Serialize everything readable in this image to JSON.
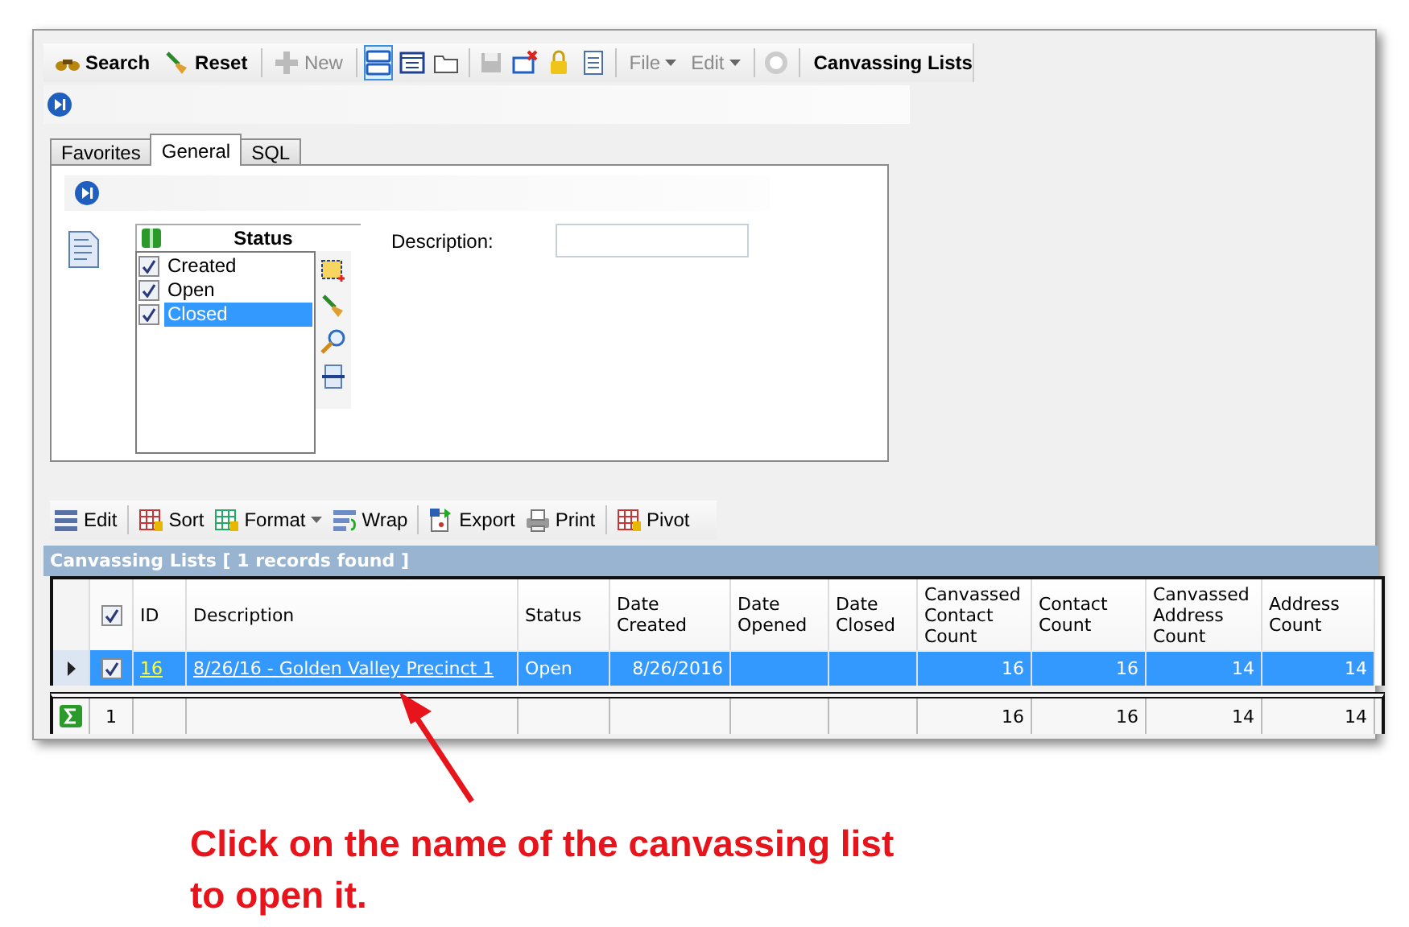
{
  "toolbar": {
    "buttons": [
      {
        "label": "Search",
        "disabled": false
      },
      {
        "label": "Reset",
        "disabled": false
      },
      {
        "label": "New",
        "disabled": true
      }
    ],
    "menus": [
      {
        "label": "File",
        "disabled": true
      },
      {
        "label": "Edit",
        "disabled": true
      }
    ],
    "title": "Canvassing Lists"
  },
  "tabs": [
    {
      "label": "Favorites",
      "selected": false
    },
    {
      "label": "General",
      "selected": true
    },
    {
      "label": "SQL",
      "selected": false
    }
  ],
  "filter": {
    "status_title": "Status",
    "statuses": [
      {
        "label": "Created",
        "checked": true,
        "selected": false
      },
      {
        "label": "Open",
        "checked": true,
        "selected": false
      },
      {
        "label": "Closed",
        "checked": true,
        "selected": true
      }
    ],
    "description_label": "Description:"
  },
  "grid_toolbar": [
    {
      "label": "Edit",
      "has_menu": false
    },
    {
      "label": "Sort",
      "has_menu": false
    },
    {
      "label": "Format",
      "has_menu": true
    },
    {
      "label": "Wrap",
      "has_menu": false
    },
    {
      "label": "Export",
      "has_menu": false
    },
    {
      "label": "Print",
      "has_menu": false
    },
    {
      "label": "Pivot",
      "has_menu": false
    }
  ],
  "grid": {
    "title": "Canvassing Lists [ 1 records found ]",
    "header_checked": true,
    "columns": [
      "ID",
      "Description",
      "Status",
      "Date Created",
      "Date Opened",
      "Date Closed",
      "Canvassed Contact Count",
      "Contact Count",
      "Canvassed Address Count",
      "Address Count"
    ],
    "rows": [
      {
        "selected": true,
        "checked": true,
        "id": "16",
        "description": "8/26/16 - Golden Valley Precinct 1",
        "status": "Open",
        "date_created": "8/26/2016",
        "canvassed_contact_count": "16",
        "contact_count": "16",
        "canvassed_address_count": "14",
        "address_count": "14"
      }
    ],
    "footer": {
      "count": "1",
      "totals": [
        "16",
        "16",
        "14",
        "14"
      ]
    }
  },
  "annotation": {
    "text": "Click on the name of the canvassing list to open it."
  }
}
